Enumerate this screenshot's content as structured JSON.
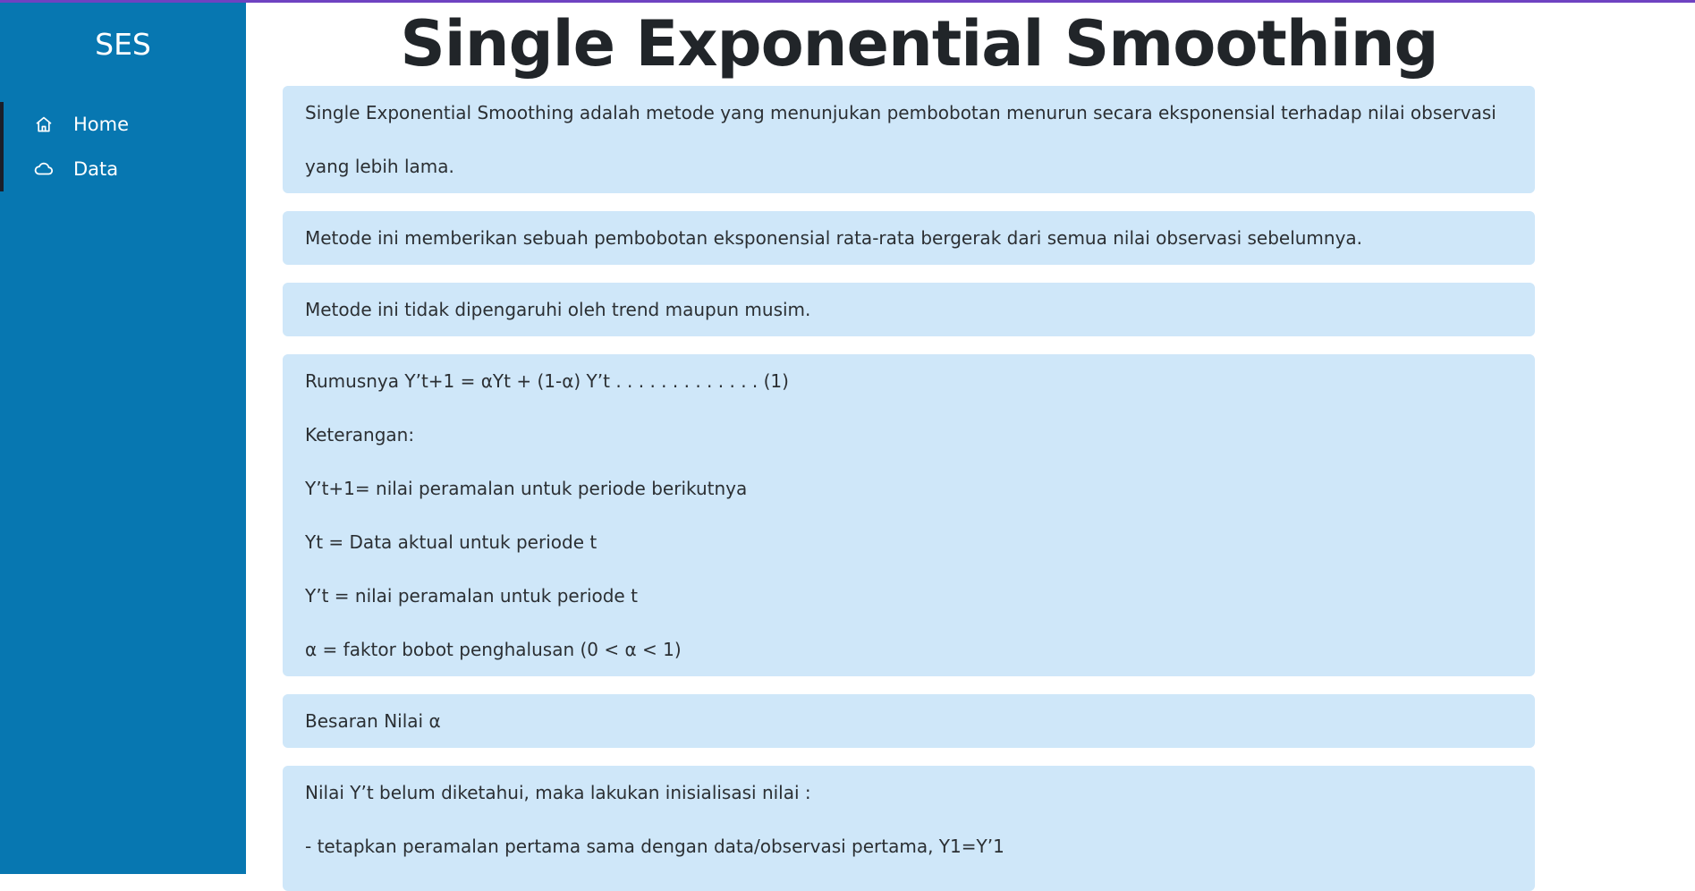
{
  "sidebar": {
    "brand": "SES",
    "items": [
      {
        "label": "Home",
        "icon": "home-icon"
      },
      {
        "label": "Data",
        "icon": "cloud-icon"
      }
    ]
  },
  "main": {
    "title": "Single Exponential Smoothing",
    "cards": [
      {
        "lines": [
          "Single Exponential Smoothing adalah metode yang menunjukan pembobotan menurun secara eksponensial terhadap nilai observasi",
          "yang lebih lama."
        ]
      },
      {
        "lines": [
          "Metode ini memberikan sebuah pembobotan eksponensial rata-rata bergerak dari semua nilai observasi sebelumnya."
        ]
      },
      {
        "lines": [
          "Metode ini tidak dipengaruhi oleh trend maupun musim."
        ]
      },
      {
        "lines": [
          "Rumusnya Y’t+1 = αYt + (1-α) Y’t . . . . . . . . . . . . . (1)",
          "Keterangan:",
          "Y’t+1= nilai peramalan untuk periode berikutnya",
          "Yt = Data aktual untuk periode t",
          "Y’t = nilai peramalan untuk periode t",
          "α = faktor bobot penghalusan (0 < α < 1)"
        ]
      },
      {
        "lines": [
          "Besaran Nilai α"
        ]
      },
      {
        "lines": [
          "Nilai Y’t belum diketahui, maka lakukan inisialisasi nilai :",
          "- tetapkan peramalan pertama sama dengan data/observasi pertama, Y1=Y’1"
        ]
      }
    ]
  },
  "colors": {
    "sidebar_bg": "#0777b1",
    "card_bg": "#cfe7f9",
    "accent_line": "#6f42c1"
  }
}
